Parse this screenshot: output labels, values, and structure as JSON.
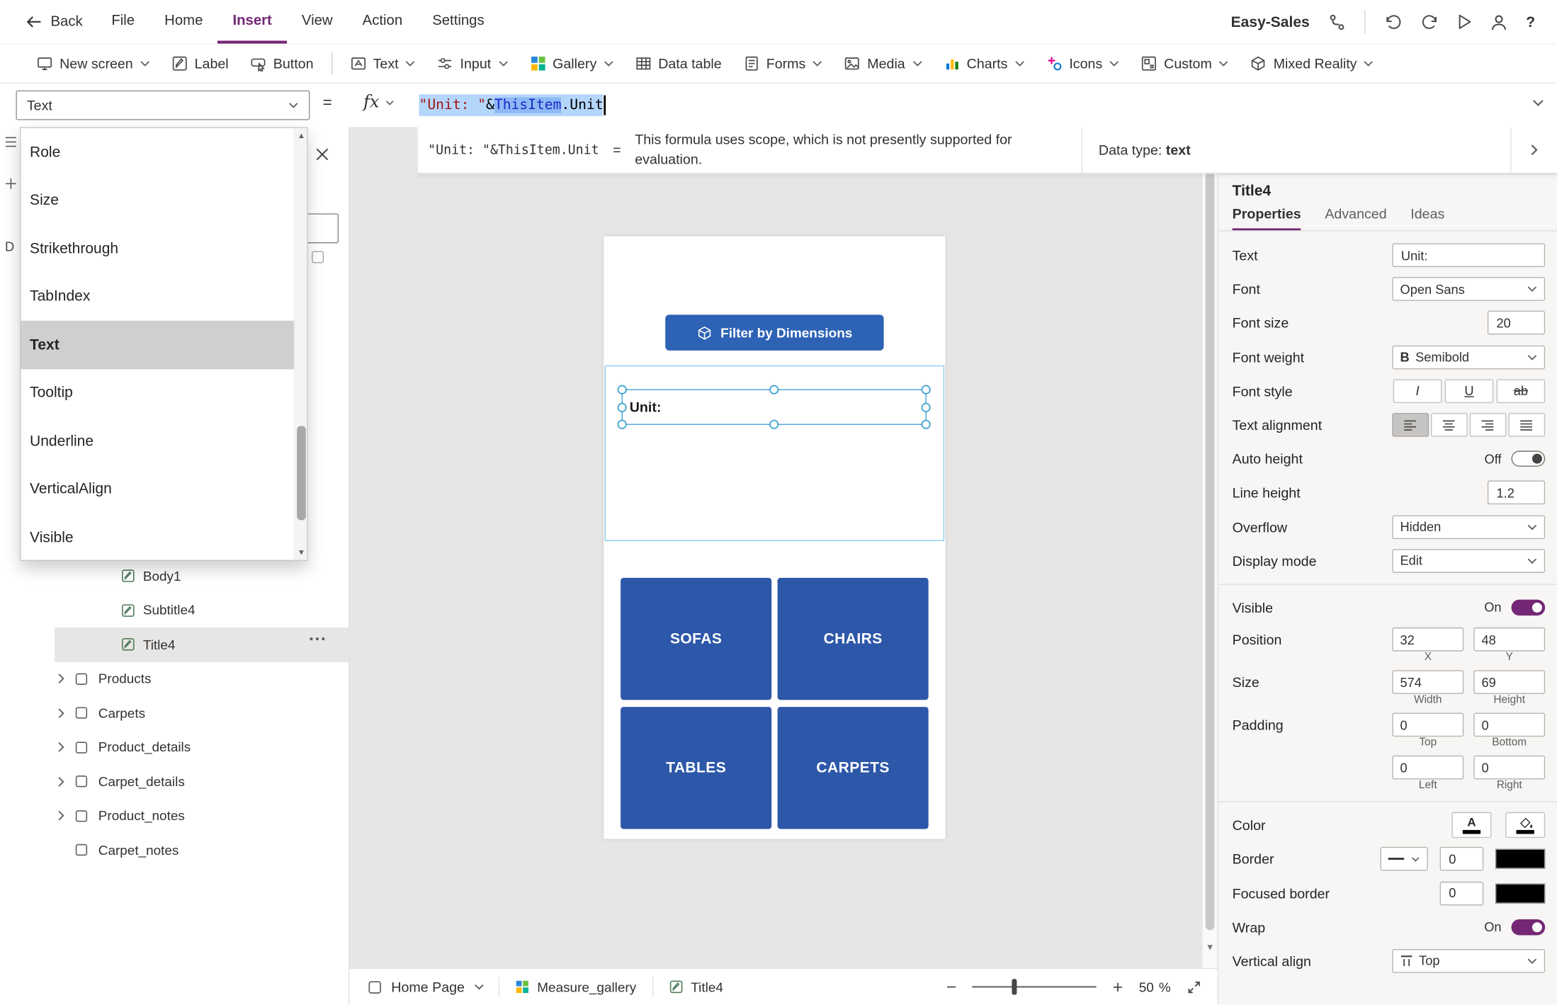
{
  "colors": {
    "accent_purple": "#742774",
    "canvas_button_blue": "#2d62b5",
    "tile_blue": "#2d57a9"
  },
  "menubar": {
    "back_label": "Back",
    "items": [
      {
        "label": "File"
      },
      {
        "label": "Home"
      },
      {
        "label": "Insert"
      },
      {
        "label": "View"
      },
      {
        "label": "Action"
      },
      {
        "label": "Settings"
      }
    ],
    "active": "Insert",
    "app_name": "Easy-Sales",
    "help_label": "?"
  },
  "toolbar": {
    "items": [
      {
        "label": "New screen"
      },
      {
        "label": "Label"
      },
      {
        "label": "Button"
      },
      {
        "label": "Text"
      },
      {
        "label": "Input"
      },
      {
        "label": "Gallery"
      },
      {
        "label": "Data table"
      },
      {
        "label": "Forms"
      },
      {
        "label": "Media"
      },
      {
        "label": "Charts"
      },
      {
        "label": "Icons"
      },
      {
        "label": "Custom"
      },
      {
        "label": "Mixed Reality"
      }
    ]
  },
  "formula_bar": {
    "property_selected": "Text",
    "equals": "=",
    "fx": "fx",
    "tokens": {
      "string": "\"Unit: \"",
      "amp": "&",
      "this_item": "ThisItem",
      "member": ".Unit"
    }
  },
  "message_bar": {
    "formula": "\"Unit: \"&ThisItem.Unit",
    "equals": "=",
    "message": "This formula uses scope, which is not presently supported for evaluation.",
    "data_type_label": "Data type:",
    "data_type_value": "text"
  },
  "property_flyout": {
    "items": [
      "Role",
      "Size",
      "Strikethrough",
      "TabIndex",
      "Text",
      "Tooltip",
      "Underline",
      "VerticalAlign",
      "Visible"
    ],
    "selected": "Text"
  },
  "rail": {
    "fragment": "D"
  },
  "tree": {
    "controls": [
      {
        "label": "Body1"
      },
      {
        "label": "Subtitle4"
      },
      {
        "label": "Title4"
      }
    ],
    "selected": "Title4",
    "screens": [
      {
        "label": "Products"
      },
      {
        "label": "Carpets"
      },
      {
        "label": "Product_details"
      },
      {
        "label": "Carpet_details"
      },
      {
        "label": "Product_notes"
      },
      {
        "label": "Carpet_notes"
      }
    ]
  },
  "canvas": {
    "filter_button_label": "Filter by Dimensions",
    "selected_text": "Unit:",
    "tiles": [
      "SOFAS",
      "CHAIRS",
      "TABLES",
      "CARPETS"
    ]
  },
  "properties_panel": {
    "title": "Title4",
    "tabs": [
      "Properties",
      "Advanced",
      "Ideas"
    ],
    "active_tab": "Properties",
    "text": {
      "label": "Text",
      "value": "Unit:"
    },
    "font": {
      "label": "Font",
      "value": "Open Sans"
    },
    "font_size": {
      "label": "Font size",
      "value": "20"
    },
    "font_weight": {
      "label": "Font weight",
      "value": "Semibold",
      "bold_glyph": "B"
    },
    "font_style": {
      "label": "Font style",
      "italic": "I",
      "underline": "U",
      "strike": "ab"
    },
    "text_alignment": {
      "label": "Text alignment"
    },
    "auto_height": {
      "label": "Auto height",
      "value": "Off"
    },
    "line_height": {
      "label": "Line height",
      "value": "1.2"
    },
    "overflow": {
      "label": "Overflow",
      "value": "Hidden"
    },
    "display_mode": {
      "label": "Display mode",
      "value": "Edit"
    },
    "visible": {
      "label": "Visible",
      "value": "On"
    },
    "position": {
      "label": "Position",
      "x": "32",
      "y": "48",
      "x_label": "X",
      "y_label": "Y"
    },
    "size": {
      "label": "Size",
      "width": "574",
      "height": "69",
      "width_label": "Width",
      "height_label": "Height"
    },
    "padding": {
      "label": "Padding",
      "top": "0",
      "bottom": "0",
      "left": "0",
      "right": "0",
      "top_label": "Top",
      "bottom_label": "Bottom",
      "left_label": "Left",
      "right_label": "Right"
    },
    "color": {
      "label": "Color",
      "glyph": "A"
    },
    "border": {
      "label": "Border",
      "width": "0"
    },
    "focused_border": {
      "label": "Focused border",
      "width": "0"
    },
    "wrap": {
      "label": "Wrap",
      "value": "On"
    },
    "vertical_align": {
      "label": "Vertical align",
      "value": "Top"
    }
  },
  "bottom_bar": {
    "screen_selector": "Home Page",
    "tabs": [
      {
        "label": "Measure_gallery"
      },
      {
        "label": "Title4"
      }
    ],
    "zoom_minus": "−",
    "zoom_plus": "+",
    "zoom_value": "50",
    "zoom_unit": "%"
  }
}
